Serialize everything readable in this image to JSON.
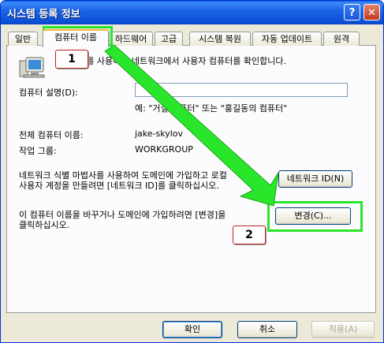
{
  "window": {
    "title": "시스템 등록 정보",
    "help_glyph": "?",
    "close_glyph": "✕"
  },
  "tabs": [
    {
      "label": "일반"
    },
    {
      "label": "컴퓨터 이름"
    },
    {
      "label": "하드웨어"
    },
    {
      "label": "고급"
    },
    {
      "label": "시스템 복원"
    },
    {
      "label": "자동 업데이트"
    },
    {
      "label": "원격"
    }
  ],
  "page": {
    "intro": "정보를 사용하여 네트워크에서 사용자 컴퓨터를 확인합니다.",
    "description_label": "컴퓨터 설명(D):",
    "description_value": "",
    "description_example": "예: \"거실 컴퓨터\" 또는 \"홍길동의 컴퓨터\"",
    "full_name_label": "전체 컴퓨터 이름:",
    "full_name_value": "jake-skylov",
    "workgroup_label": "작업 그룹:",
    "workgroup_value": "WORKGROUP",
    "network_text_1": "네트워크 식별 마법사를 사용하여 도메인에 가입하고 로컬",
    "network_text_2": "사용자 계정을 만들려면 [네트워크 ID]를 클릭하십시오.",
    "network_id_button": "네트워크 ID(N)",
    "change_text_1": "이 컴퓨터 이름을 바꾸거나 도메인에 가입하려면 [변경]을",
    "change_text_2": "클릭하십시오.",
    "change_button": "변경(C)..."
  },
  "annotations": {
    "marker1": "1",
    "marker2": "2"
  },
  "footer": {
    "ok": "확인",
    "cancel": "취소",
    "apply": "적용(A)"
  },
  "colors": {
    "highlight": "#2ae62a",
    "titlebar": "#0a4fd6"
  }
}
